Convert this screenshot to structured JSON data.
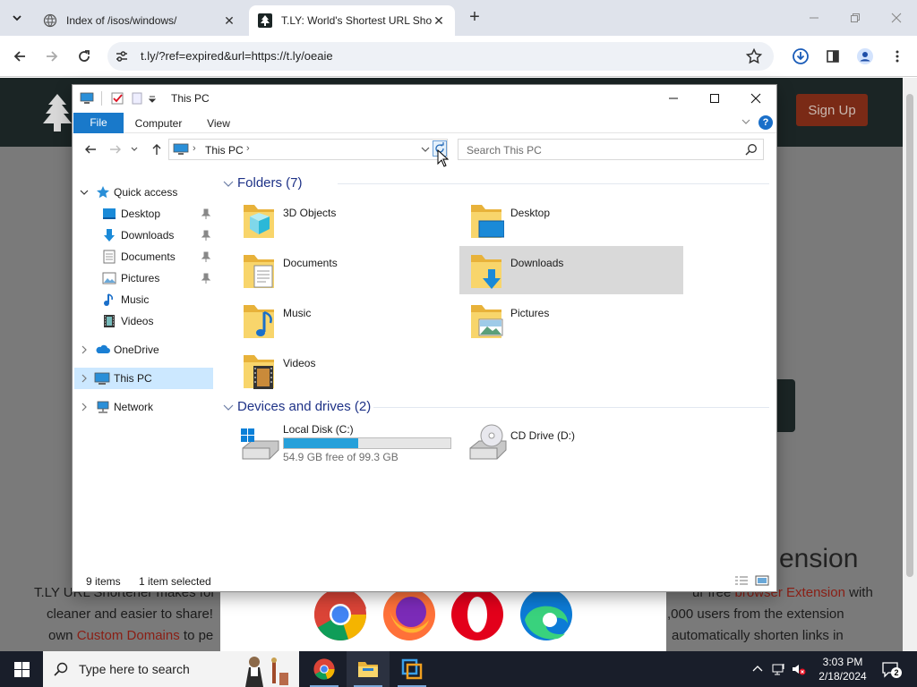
{
  "browser": {
    "tabs": [
      {
        "title": "Index of /isos/windows/"
      },
      {
        "title": "T.LY: World's Shortest URL Shor"
      }
    ],
    "url": "t.ly/?ref=expired&url=https://t.ly/oeaie"
  },
  "website": {
    "signup_label": "Sign Up",
    "extension_heading": "ension",
    "line1_a": "T.LY URL Shortener makes for",
    "line1_b": "ur free ",
    "line1_link": "browser Extension",
    "line1_c": " with",
    "line2_a": "cleaner and easier to share!",
    "line2_b": ",000 users from the extension",
    "line3_a": "own ",
    "line3_link": "Custom Domains",
    "line3_b": " to pe",
    "line3_c": "automatically shorten links in"
  },
  "explorer": {
    "title": "This PC",
    "ribbon_tabs": [
      "File",
      "Computer",
      "View"
    ],
    "help": "?",
    "breadcrumb": "This PC",
    "search_placeholder": "Search This PC",
    "nav": {
      "quick_access": "Quick access",
      "desktop": "Desktop",
      "downloads": "Downloads",
      "documents": "Documents",
      "pictures": "Pictures",
      "music": "Music",
      "videos": "Videos",
      "onedrive": "OneDrive",
      "this_pc": "This PC",
      "network": "Network"
    },
    "folders_header": "Folders (7)",
    "folders": [
      "3D Objects",
      "Desktop",
      "Documents",
      "Downloads",
      "Music",
      "Pictures",
      "Videos"
    ],
    "drives_header": "Devices and drives (2)",
    "drive_c": {
      "name": "Local Disk (C:)",
      "free": "54.9 GB free of 99.3 GB",
      "used_fraction": 0.447
    },
    "drive_d": {
      "name": "CD Drive (D:)"
    },
    "status_items": "9 items",
    "status_selected": "1 item selected"
  },
  "taskbar": {
    "search_text": "Type here to search",
    "time": "3:03 PM",
    "date": "2/18/2024",
    "notifications": "2"
  },
  "colors": {
    "accent": "#1979ca",
    "selection": "#cce8ff",
    "drive_bar": "#26a0da",
    "group_title": "#1e3287"
  }
}
